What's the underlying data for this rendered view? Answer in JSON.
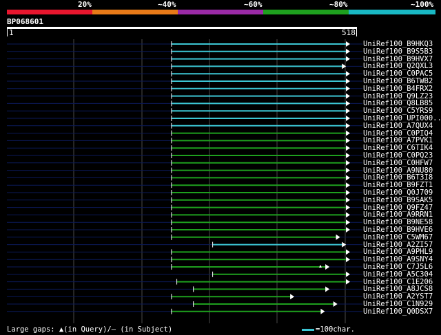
{
  "scale": {
    "labels": [
      "20%",
      "~40%",
      "~60%",
      "~80%",
      "~100%"
    ],
    "colors": [
      "#e8162e",
      "#e87a18",
      "#9a2aa6",
      "#1ea01e",
      "#19b8c4"
    ]
  },
  "query": {
    "id": "BP068601",
    "start": "1",
    "end": "518",
    "length": 518
  },
  "hits": [
    {
      "label": "UniRef100_B9HKQ3",
      "start": 249,
      "end": 518,
      "color": "cyan"
    },
    {
      "label": "UniRef100_B9S5B3",
      "start": 249,
      "end": 518,
      "color": "cyan"
    },
    {
      "label": "UniRef100_B9HVX7",
      "start": 249,
      "end": 518,
      "color": "cyan"
    },
    {
      "label": "UniRef100_Q2QXL3",
      "start": 249,
      "end": 512,
      "color": "cyan"
    },
    {
      "label": "UniRef100_C0PAC5",
      "start": 249,
      "end": 518,
      "color": "cyan"
    },
    {
      "label": "UniRef100_B6TWB2",
      "start": 249,
      "end": 518,
      "color": "cyan"
    },
    {
      "label": "UniRef100_B4FRX2",
      "start": 249,
      "end": 518,
      "color": "cyan"
    },
    {
      "label": "UniRef100_Q9LZ23",
      "start": 249,
      "end": 518,
      "color": "cyan"
    },
    {
      "label": "UniRef100_Q8LB85",
      "start": 249,
      "end": 518,
      "color": "cyan"
    },
    {
      "label": "UniRef100_C5YRS9",
      "start": 249,
      "end": 518,
      "color": "cyan"
    },
    {
      "label": "UniRef100_UPI000..",
      "start": 249,
      "end": 518,
      "color": "cyan"
    },
    {
      "label": "UniRef100_A7QUX4",
      "start": 249,
      "end": 518,
      "color": "cyan"
    },
    {
      "label": "UniRef100_C0PIQ4",
      "start": 249,
      "end": 518,
      "color": "green"
    },
    {
      "label": "UniRef100_A7PVK1",
      "start": 249,
      "end": 518,
      "color": "green"
    },
    {
      "label": "UniRef100_C6TIK4",
      "start": 249,
      "end": 518,
      "color": "green"
    },
    {
      "label": "UniRef100_C0PQ23",
      "start": 249,
      "end": 518,
      "color": "green"
    },
    {
      "label": "UniRef100_C0HFW7",
      "start": 249,
      "end": 518,
      "color": "green"
    },
    {
      "label": "UniRef100_A9NU80",
      "start": 249,
      "end": 518,
      "color": "green"
    },
    {
      "label": "UniRef100_B6T3I8",
      "start": 249,
      "end": 518,
      "color": "green"
    },
    {
      "label": "UniRef100_B9FZT1",
      "start": 249,
      "end": 518,
      "color": "green"
    },
    {
      "label": "UniRef100_Q0J709",
      "start": 249,
      "end": 518,
      "color": "green"
    },
    {
      "label": "UniRef100_B9SAK5",
      "start": 249,
      "end": 518,
      "color": "green"
    },
    {
      "label": "UniRef100_Q9FZ47",
      "start": 249,
      "end": 518,
      "color": "green"
    },
    {
      "label": "UniRef100_A9RRN1",
      "start": 249,
      "end": 518,
      "color": "green"
    },
    {
      "label": "UniRef100_B9NE58",
      "start": 249,
      "end": 518,
      "color": "green"
    },
    {
      "label": "UniRef100_B9HVE6",
      "start": 249,
      "end": 518,
      "color": "green"
    },
    {
      "label": "UniRef100_C5WM67",
      "start": 249,
      "end": 503,
      "color": "green"
    },
    {
      "label": "UniRef100_A2ZI57",
      "start": 311,
      "end": 512,
      "color": "cyan"
    },
    {
      "label": "UniRef100_A9PHL9",
      "start": 249,
      "end": 518,
      "color": "green"
    },
    {
      "label": "UniRef100_A9SNY4",
      "start": 249,
      "end": 518,
      "color": "green"
    },
    {
      "label": "UniRef100_C7J5L6",
      "start": 249,
      "end": 487,
      "color": "green"
    },
    {
      "label": "UniRef100_A5C304",
      "start": 311,
      "end": 518,
      "color": "green"
    },
    {
      "label": "UniRef100_C1E206",
      "start": 257,
      "end": 518,
      "color": "green"
    },
    {
      "label": "UniRef100_A8JCS8",
      "start": 282,
      "end": 487,
      "color": "green"
    },
    {
      "label": "UniRef100_A2YST7",
      "start": 249,
      "end": 434,
      "color": "green"
    },
    {
      "label": "UniRef100_C1N929",
      "start": 282,
      "end": 499,
      "color": "green"
    },
    {
      "label": "UniRef100_Q0DSX7",
      "start": 249,
      "end": 480,
      "color": "green"
    }
  ],
  "footer": {
    "gaps_text": "Large gaps: ▲(in Query)/– (in Subject)",
    "legend_text": "=100char."
  }
}
